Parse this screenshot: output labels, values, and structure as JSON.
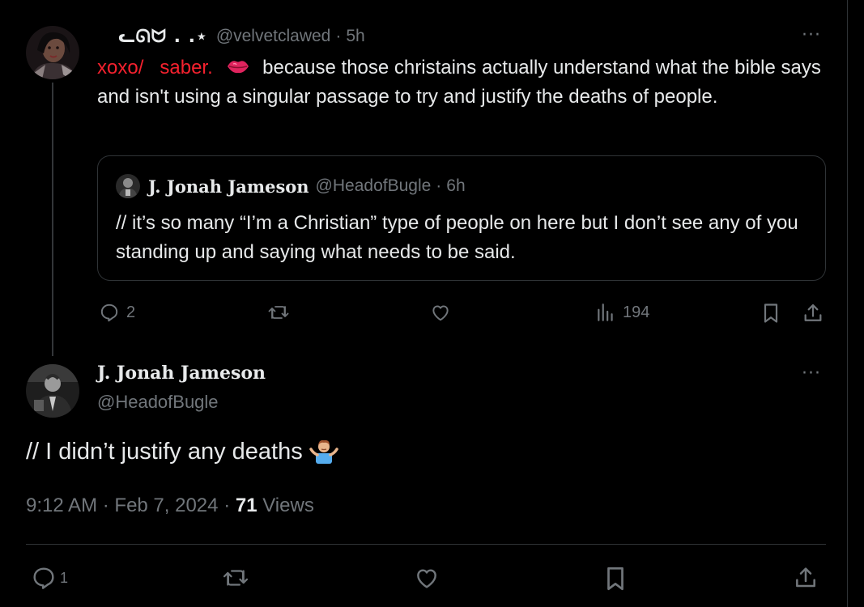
{
  "reply_tweet": {
    "display_name": "ᓚᘏᗢ .  .⋆",
    "handle": "@velvetclawed",
    "separator": "·",
    "time": "5h",
    "more": "···",
    "mention_1": "xoxo/",
    "mention_2": "saber.",
    "emoji_icon": "kiss-mark-icon",
    "text": "because those christains actually understand what the bible says and isn't using a singular passage to try and justify the deaths of people.",
    "quoted": {
      "display_name": "J. Jonah Jameson",
      "handle": "@HeadofBugle",
      "separator": "·",
      "time": "6h",
      "text": "// it’s so many “I’m a Christian” type of people on here but I don’t see any of you standing up and saying what needs to be said."
    },
    "actions": {
      "replies": "2",
      "reposts": "",
      "likes": "",
      "views": "194"
    }
  },
  "main_tweet": {
    "display_name": "J. Jonah Jameson",
    "handle": "@HeadofBugle",
    "more": "···",
    "text": "// I didn’t justify any deaths",
    "emoji_icon": "person-shrugging-icon",
    "time": "9:12 AM",
    "date": "Feb 7, 2024",
    "separator": "·",
    "views_count": "71",
    "views_label": "Views",
    "actions": {
      "replies": "1"
    }
  },
  "colors": {
    "background": "#000000",
    "text": "#e7e9ea",
    "muted": "#71767b",
    "border": "#2f3336",
    "mention": "#f4212e"
  }
}
